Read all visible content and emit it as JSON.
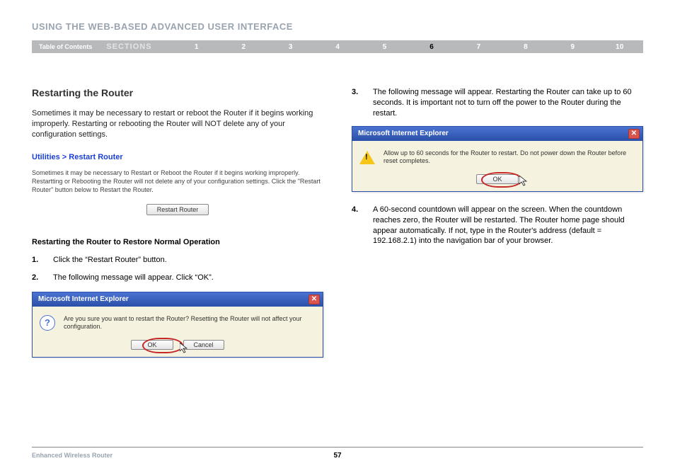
{
  "header": {
    "title": "USING THE WEB-BASED ADVANCED USER INTERFACE"
  },
  "nav": {
    "toc_label": "Table of Contents",
    "sections_label": "SECTIONS",
    "items": [
      "1",
      "2",
      "3",
      "4",
      "5",
      "6",
      "7",
      "8",
      "9",
      "10"
    ],
    "active_index": 5
  },
  "main": {
    "title": "Restarting the Router",
    "intro": "Sometimes it may be necessary to restart or reboot the Router if it begins working improperly. Restarting or rebooting the Router will NOT delete any of your configuration settings.",
    "restart_panel": {
      "breadcrumb": "Utilities > Restart Router",
      "description": "Sometimes it may be necessary to Restart or Reboot the Router if it begins working improperly. Restartting or Rebooting the Router will not delete any of your configuration settings. Click the \"Restart Router\" button below to Restart the Router.",
      "button_label": "Restart Router"
    },
    "subheading": "Restarting the Router to Restore Normal Operation",
    "left_steps": [
      {
        "num": "1.",
        "text": "Click the “Restart Router” button."
      },
      {
        "num": "2.",
        "text": "The following message will appear. Click “OK”."
      }
    ],
    "right_steps": [
      {
        "num": "3.",
        "text": "The following message will appear. Restarting the Router can take up to 60 seconds. It is important not to turn off the power to the Router during the restart."
      },
      {
        "num": "4.",
        "text": "A 60-second countdown will appear on the screen. When the countdown reaches zero, the Router will be restarted. The Router home page should appear automatically. If not, type in the Router's address (default = 192.168.2.1) into the navigation bar of your browser."
      }
    ],
    "dialog1": {
      "title": "Microsoft Internet Explorer",
      "message": "Are you sure you want to restart the Router? Resetting the Router will not affect your configuration.",
      "ok": "OK",
      "cancel": "Cancel"
    },
    "dialog2": {
      "title": "Microsoft Internet Explorer",
      "message": "Allow up to 60 seconds for the Router to restart. Do not power down the Router before reset completes.",
      "ok": "OK"
    }
  },
  "footer": {
    "product": "Enhanced Wireless Router",
    "page": "57"
  }
}
